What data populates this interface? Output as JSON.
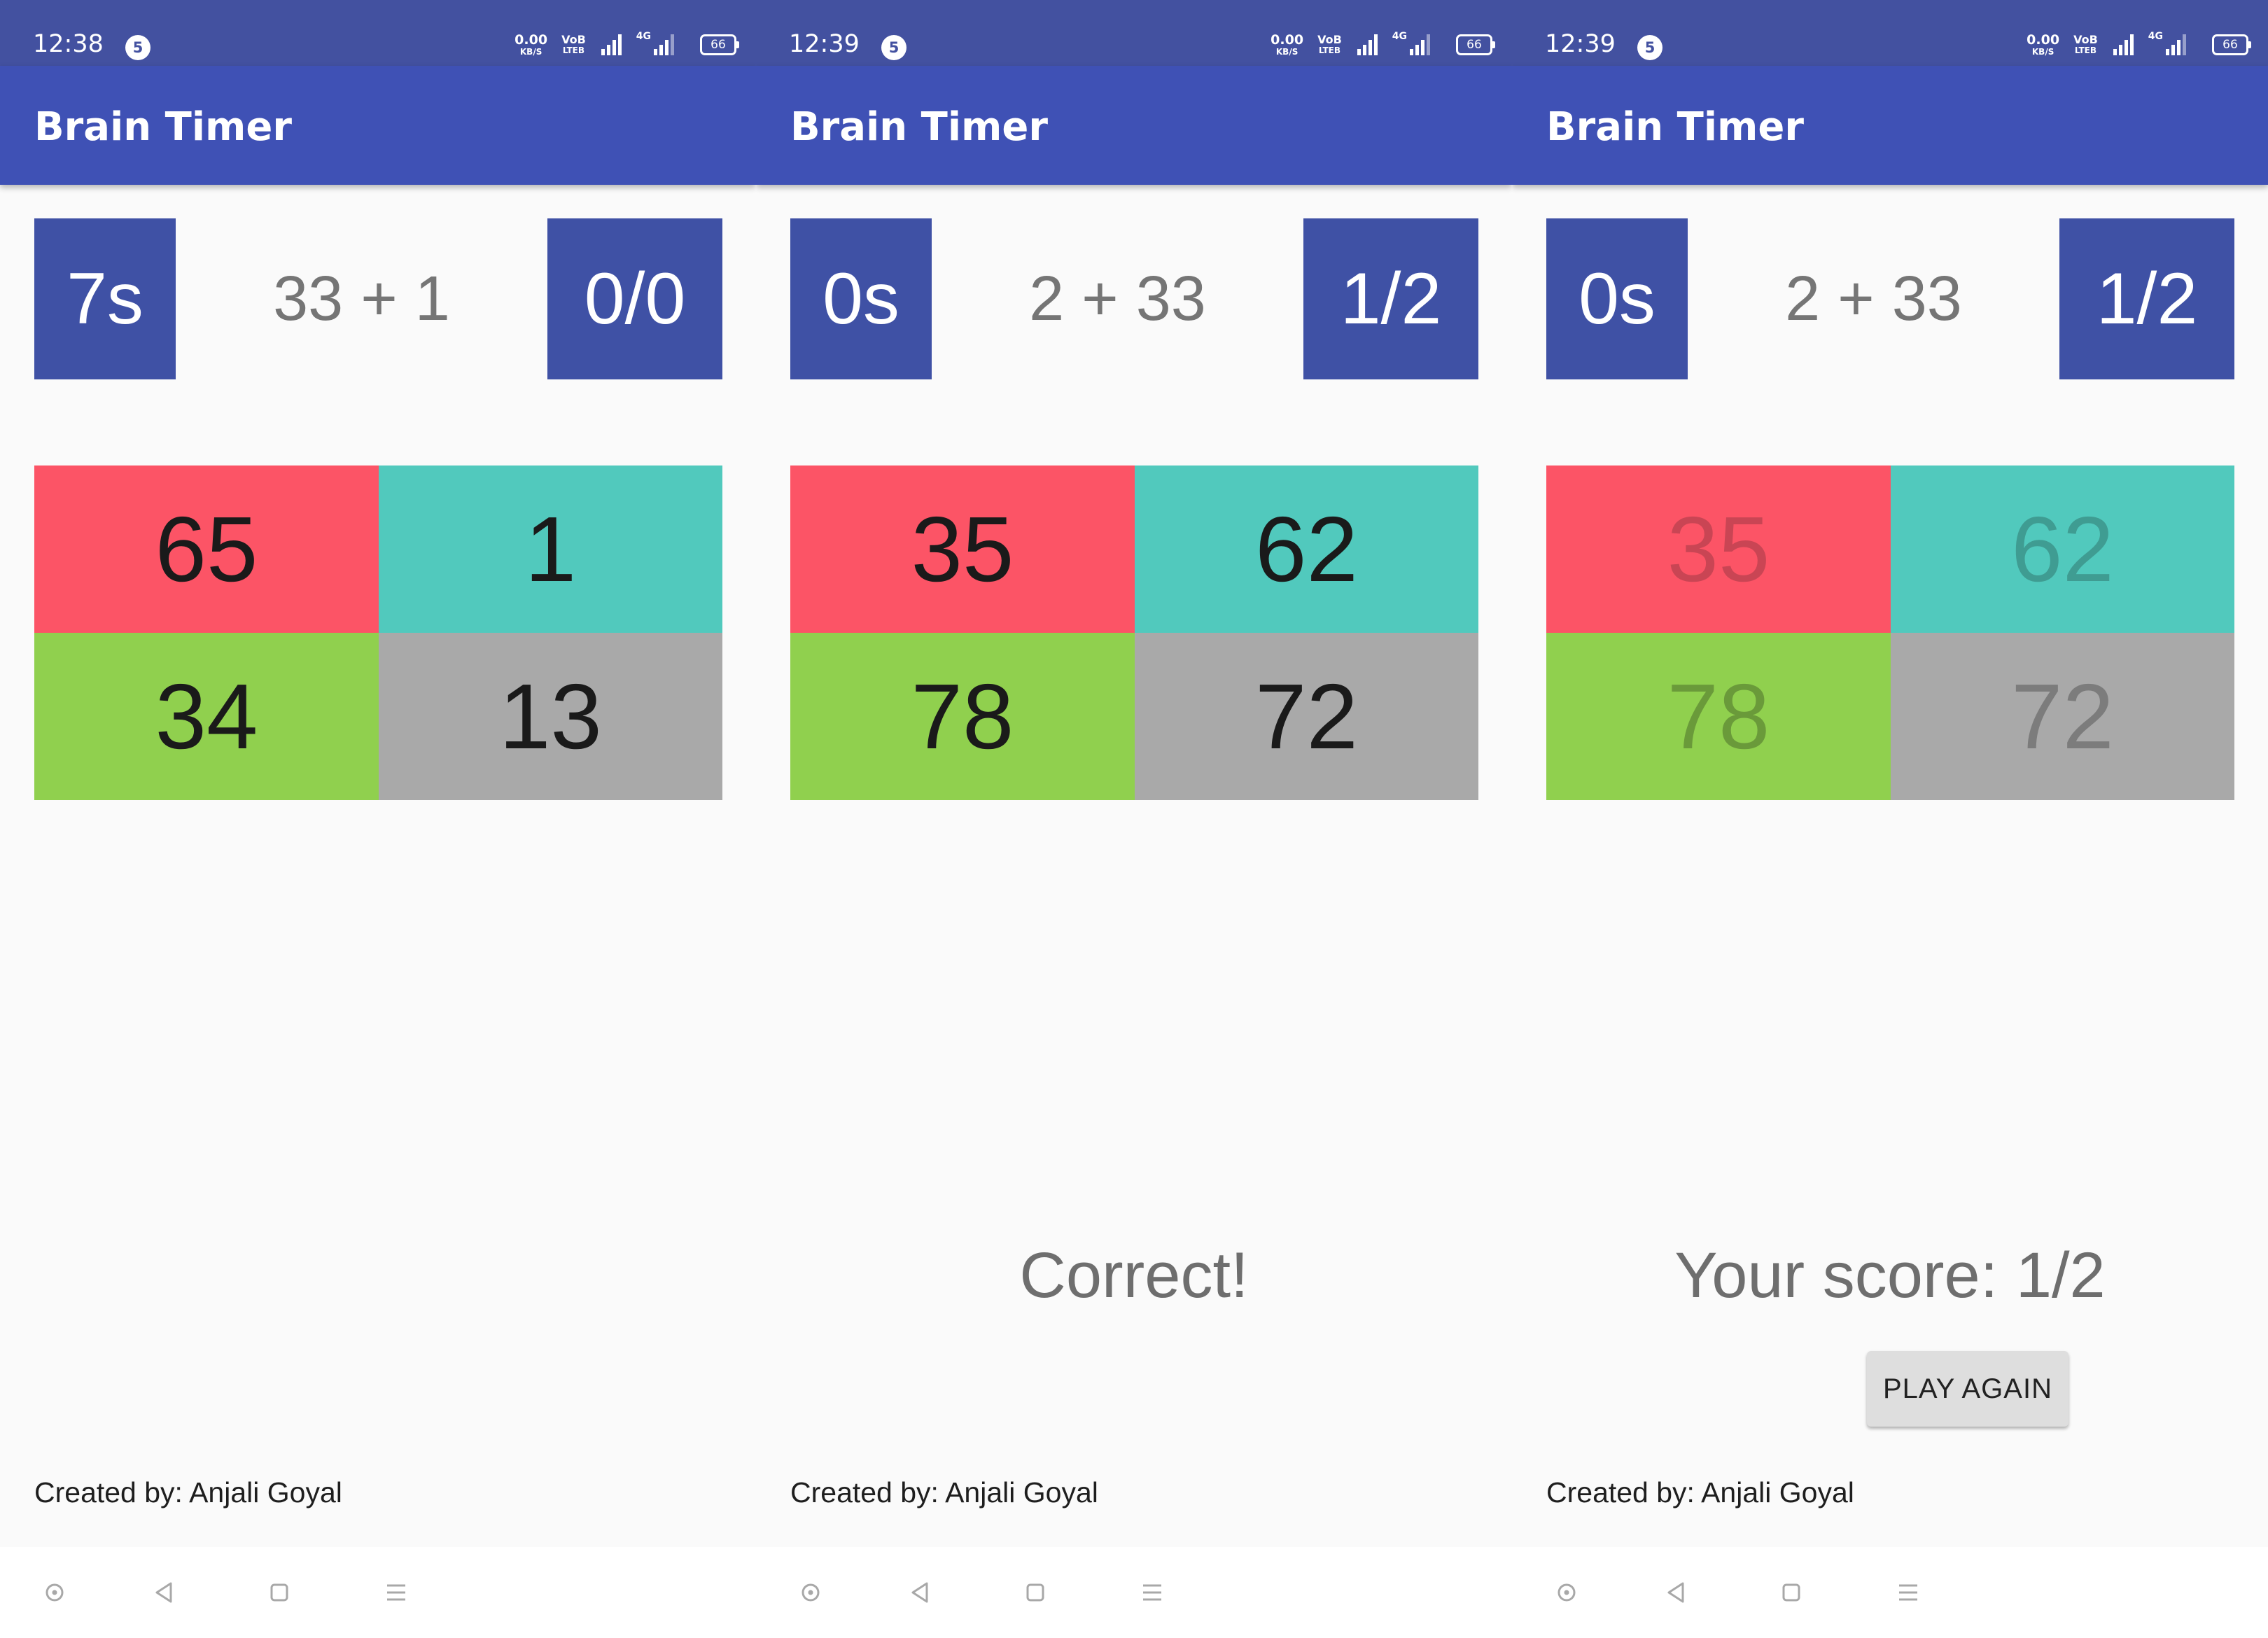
{
  "screens": [
    {
      "status": {
        "time": "12:38",
        "badge": "5",
        "net_speed": "0.00",
        "net_unit": "KB/S",
        "volte_top": "VoB",
        "volte_bottom": "LTEB",
        "network": "4G",
        "battery": "66"
      },
      "app": {
        "title": "Brain Timer"
      },
      "game": {
        "timer": "7s",
        "question": "33 + 1",
        "score": "0/0",
        "answers": [
          "65",
          "1",
          "34",
          "13"
        ]
      },
      "result_text": "",
      "play_again_label": "",
      "credit": "Created by: Anjali Goyal"
    },
    {
      "status": {
        "time": "12:39",
        "badge": "5",
        "net_speed": "0.00",
        "net_unit": "KB/S",
        "volte_top": "VoB",
        "volte_bottom": "LTEB",
        "network": "4G",
        "battery": "66"
      },
      "app": {
        "title": "Brain Timer"
      },
      "game": {
        "timer": "0s",
        "question": "2 + 33",
        "score": "1/2",
        "answers": [
          "35",
          "62",
          "78",
          "72"
        ]
      },
      "result_text": "Correct!",
      "play_again_label": "",
      "credit": "Created by: Anjali Goyal"
    },
    {
      "status": {
        "time": "12:39",
        "badge": "5",
        "net_speed": "0.00",
        "net_unit": "KB/S",
        "volte_top": "VoB",
        "volte_bottom": "LTEB",
        "network": "4G",
        "battery": "66"
      },
      "app": {
        "title": "Brain Timer"
      },
      "game": {
        "timer": "0s",
        "question": "2 + 33",
        "score": "1/2",
        "answers": [
          "35",
          "62",
          "78",
          "72"
        ]
      },
      "result_text": "Your score: 1/2",
      "play_again_label": "PLAY AGAIN",
      "credit": "Created by: Anjali Goyal"
    }
  ],
  "answer_colors": [
    "#fc5466",
    "#51c9bd",
    "#90d04e",
    "#a9a9a9"
  ],
  "theme": {
    "status_bar": "#4351a0",
    "app_bar": "#3f51b5",
    "tile": "#3f51a5"
  },
  "nav_icons": [
    "assistant-dot-icon",
    "back-triangle-icon",
    "home-square-icon",
    "menu-lines-icon"
  ]
}
